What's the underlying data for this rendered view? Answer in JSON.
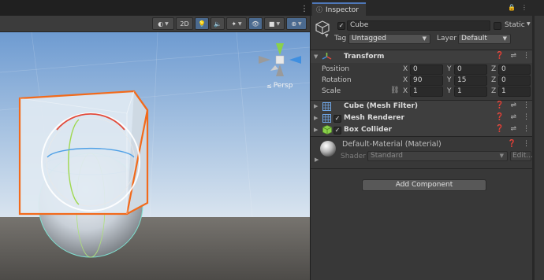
{
  "scene": {
    "toolbar": {
      "shading_label": "",
      "mode_2d_label": "2D"
    },
    "gizmo": {
      "projection_label": "Persp"
    }
  },
  "inspector": {
    "tab_label": "Inspector",
    "object": {
      "active": true,
      "name": "Cube",
      "static_label": "Static",
      "tag_label": "Tag",
      "tag_value": "Untagged",
      "layer_label": "Layer",
      "layer_value": "Default"
    },
    "transform": {
      "title": "Transform",
      "position": {
        "label": "Position",
        "x": "0",
        "y": "0",
        "z": "0"
      },
      "rotation": {
        "label": "Rotation",
        "x": "90",
        "y": "15",
        "z": "0"
      },
      "scale": {
        "label": "Scale",
        "x": "1",
        "y": "1",
        "z": "1"
      },
      "axis_x": "X",
      "axis_y": "Y",
      "axis_z": "Z"
    },
    "components": [
      {
        "name": "Cube (Mesh Filter)",
        "has_checkbox": false
      },
      {
        "name": "Mesh Renderer",
        "has_checkbox": true,
        "enabled": true
      },
      {
        "name": "Box Collider",
        "has_checkbox": true,
        "enabled": true
      }
    ],
    "material": {
      "name": "Default-Material (Material)",
      "shader_label": "Shader",
      "shader_value": "Standard",
      "edit_label": "Edit..."
    },
    "add_component_label": "Add Component"
  },
  "colors": {
    "accent": "#4f78b9",
    "selection_outline": "#f26a1b",
    "sky_top": "#6f9bd0",
    "ground": "#5f5d5a"
  },
  "icons": {
    "scene_toolbar": [
      "shading-mode-icon",
      "lighting-icon",
      "audio-icon",
      "effects-icon",
      "scene-visibility-icon",
      "camera-icon",
      "gizmos-icon"
    ],
    "inspector": [
      "lock-icon",
      "kebab-menu-icon",
      "cube-icon",
      "transform-icon",
      "mesh-filter-icon",
      "mesh-renderer-icon",
      "box-collider-icon",
      "material-sphere-icon",
      "help-icon",
      "preset-icon"
    ]
  }
}
